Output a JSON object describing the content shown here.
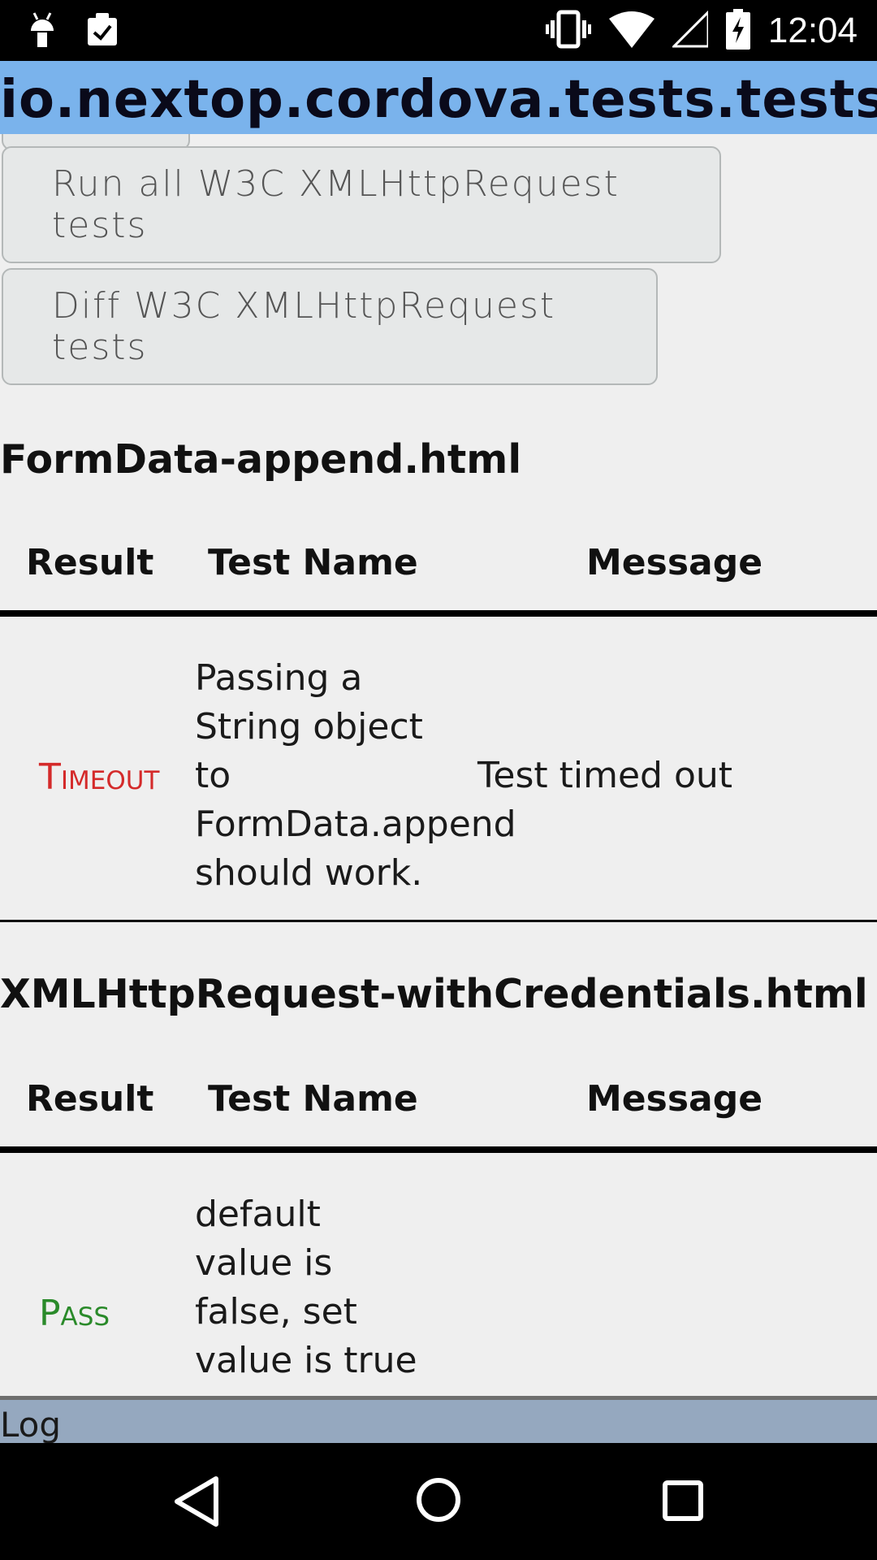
{
  "status_bar": {
    "left_icons": [
      "android-debug-icon",
      "clipboard-check-icon"
    ],
    "right_icons": [
      "vibrate-icon",
      "wifi-icon",
      "no-signal-icon",
      "battery-charging-icon"
    ],
    "time": "12:04"
  },
  "app": {
    "title": "io.nextop.cordova.tests.tests"
  },
  "buttons": {
    "run_all": "Run all W3C XMLHttpRequest tests",
    "diff": "Diff W3C XMLHttpRequest tests"
  },
  "sections": [
    {
      "title": "FormData-append.html",
      "headers": {
        "result": "Result",
        "test_name": "Test Name",
        "message": "Message"
      },
      "rows": [
        {
          "result": "Timeout",
          "test_name": [
            "Passing a",
            "String object",
            "to",
            "FormData.append",
            "should work."
          ],
          "message": "Test timed out"
        }
      ]
    },
    {
      "title": "XMLHttpRequest-withCredentials.html",
      "headers": {
        "result": "Result",
        "test_name": "Test Name",
        "message": "Message"
      },
      "rows": [
        {
          "result": "Pass",
          "test_name": [
            "default",
            "value is",
            "false, set",
            "value is true"
          ],
          "message": ""
        }
      ]
    }
  ],
  "log": {
    "label": "Log"
  },
  "nav": {
    "icons": [
      "back-icon",
      "home-icon",
      "recents-icon"
    ]
  },
  "colors": {
    "title_bar": "#7ab3ec",
    "timeout": "#d42a2a",
    "pass": "#2a8a2a",
    "log_bar": "#95a8bf"
  }
}
